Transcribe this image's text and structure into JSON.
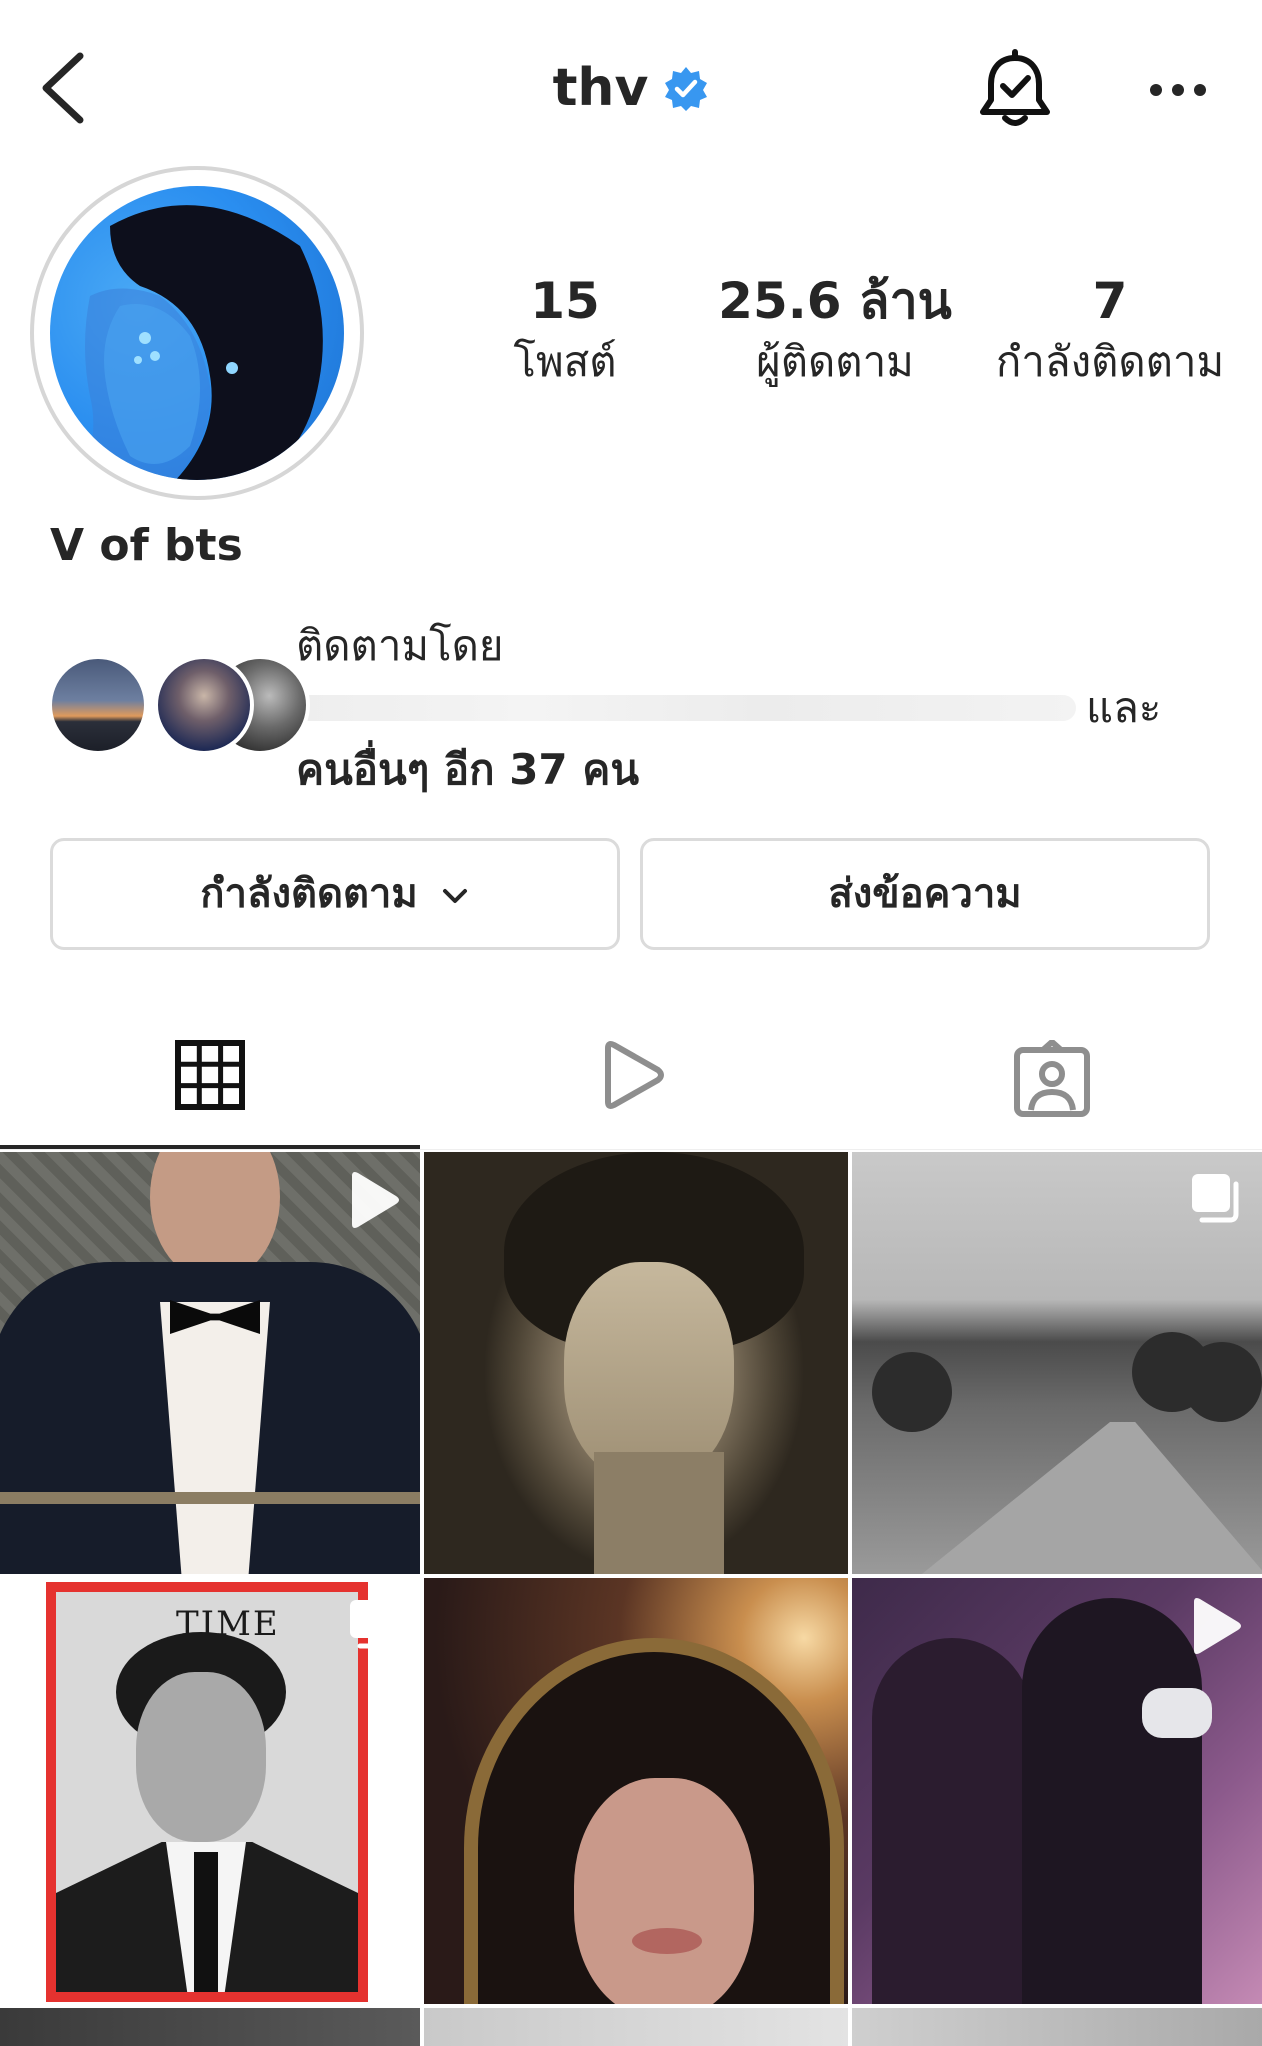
{
  "header": {
    "username": "thv",
    "verified": true
  },
  "stats": {
    "posts": {
      "value": "15",
      "label": "โพสต์"
    },
    "followers": {
      "value": "25.6 ล้าน",
      "label": "ผู้ติดตาม"
    },
    "following": {
      "value": "7",
      "label": "กำลังติดตาม"
    }
  },
  "profile": {
    "display_name": "V of bts"
  },
  "followed_by": {
    "prefix": "ติดตามโดย",
    "and": "และ",
    "others": "คนอื่นๆ อีก 37 คน"
  },
  "actions": {
    "following_label": "กำลังติดตาม",
    "message_label": "ส่งข้อความ"
  },
  "tabs": [
    {
      "icon": "grid-icon",
      "active": true
    },
    {
      "icon": "reels-icon",
      "active": false
    },
    {
      "icon": "tagged-icon",
      "active": false
    }
  ],
  "posts": [
    {
      "badge": "reel-icon"
    },
    {
      "badge": null
    },
    {
      "badge": "carousel-icon"
    },
    {
      "badge": "carousel-icon",
      "cover_text": "TIME"
    },
    {
      "badge": null
    },
    {
      "badge": "reel-icon"
    }
  ],
  "colors": {
    "verified": "#3897f0",
    "text": "#262626",
    "border": "#dbdbdb",
    "time_red": "#e5322f"
  }
}
